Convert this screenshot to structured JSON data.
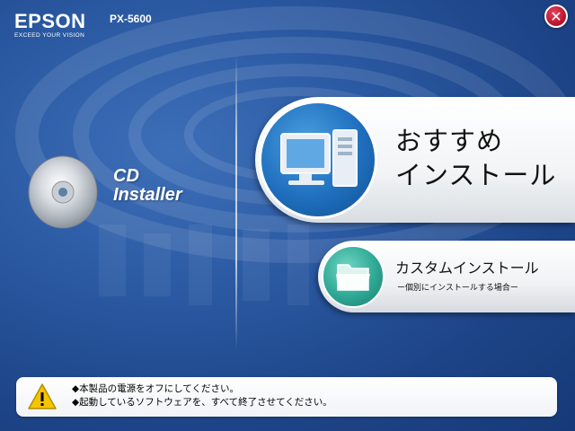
{
  "header": {
    "brand": "EPSON",
    "tagline": "EXCEED YOUR VISION",
    "model": "PX-5600",
    "close_glyph": "✕"
  },
  "cd_installer": {
    "title_line1": "CD",
    "title_line2": "Installer",
    "icon": "cd-disc-icon"
  },
  "recommended_install": {
    "label": "おすすめ\nインストール",
    "icon": "computer-icon"
  },
  "custom_install": {
    "label": "カスタムインストール",
    "sub": "ー個別にインストールする場合ー",
    "icon": "folder-icon"
  },
  "notice": {
    "icon": "warning-icon",
    "lines": [
      "◆本製品の電源をオフにしてください。",
      "◆起動しているソフトウェアを、すべて終了させてください。"
    ]
  },
  "colors": {
    "background": "#2b5aa3",
    "recommended_circle": "#1f6fbe",
    "custom_circle": "#2ea894",
    "close_button": "#c41a33",
    "warning": "#f5c400"
  }
}
